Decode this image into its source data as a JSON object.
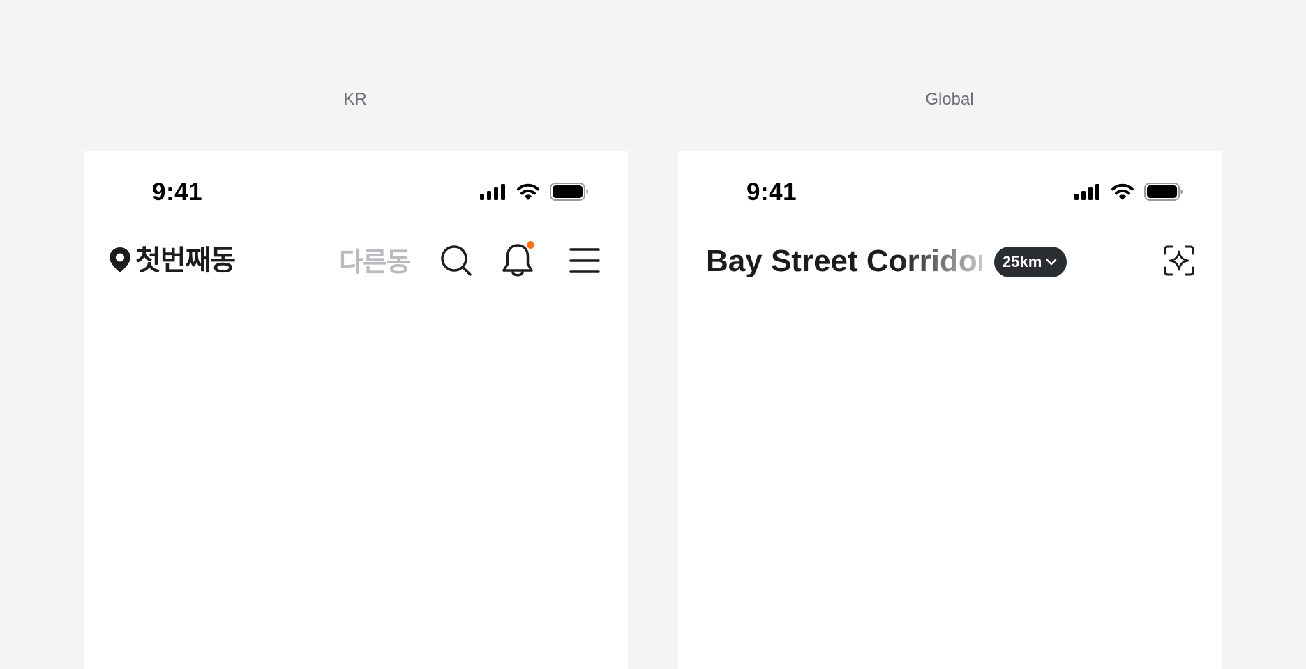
{
  "labels": {
    "kr": "KR",
    "global": "Global"
  },
  "kr_screen": {
    "status_time": "9:41",
    "title": "첫번째동",
    "other_neighborhood": "다른동",
    "icons": [
      "location-pin-icon",
      "search-icon",
      "bell-icon",
      "menu-icon"
    ],
    "notification_dot_color": "#ff6f0f"
  },
  "global_screen": {
    "status_time": "9:41",
    "title": "Bay Street Corridor",
    "distance": "25km",
    "icons": [
      "chevron-down-icon",
      "sparkle-scan-icon"
    ]
  },
  "colors": {
    "background": "#f4f4f4",
    "screen": "#ffffff",
    "text_primary": "#1b1c1e",
    "text_muted": "#b9bbbf",
    "pill": "#2a2e33"
  }
}
